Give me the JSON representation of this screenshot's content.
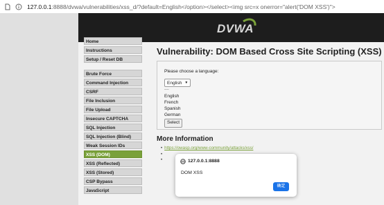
{
  "browser": {
    "url_host": "127.0.0.1",
    "url_rest": ":8888/dvwa/vulnerabilities/xss_d/?default=English</option></select><img src=x onerror=\"alert('DOM XSS')\">"
  },
  "logo": {
    "text": "DVWA"
  },
  "sidebar": {
    "groups": [
      [
        "Home",
        "Instructions",
        "Setup / Reset DB"
      ],
      [
        "Brute Force",
        "Command Injection",
        "CSRF",
        "File Inclusion",
        "File Upload",
        "Insecure CAPTCHA",
        "SQL Injection",
        "SQL Injection (Blind)",
        "Weak Session IDs",
        "XSS (DOM)",
        "XSS (Reflected)",
        "XSS (Stored)",
        "CSP Bypass",
        "JavaScript"
      ]
    ],
    "selected": "XSS (DOM)"
  },
  "main": {
    "title": "Vulnerability: DOM Based Cross Site Scripting (XSS)",
    "prompt": "Please choose a language:",
    "selected_language": "English",
    "dashes": "----",
    "options": [
      "English",
      "French",
      "Spanish",
      "German"
    ],
    "select_button": "Select",
    "more_info_heading": "More Information",
    "links": [
      "https://owasp.org/www-community/attacks/xss/"
    ]
  },
  "dialog": {
    "origin": "127.0.0.1:8888",
    "message": "DOM XSS",
    "ok_label": "确定"
  },
  "colors": {
    "accent": "#7aa13a",
    "banner": "#1d1d1d",
    "dialog_button": "#1a73e8"
  }
}
